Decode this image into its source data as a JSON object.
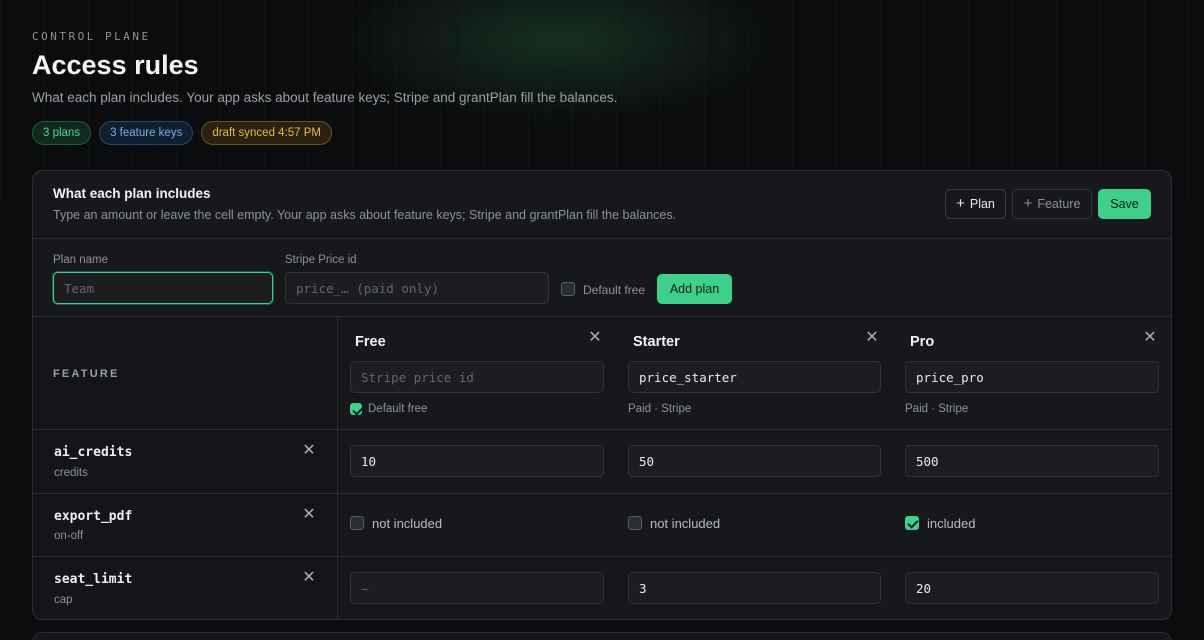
{
  "header": {
    "eyebrow": "CONTROL PLANE",
    "title": "Access rules",
    "subtitle": "What each plan includes. Your app asks about feature keys; Stripe and grantPlan fill the balances.",
    "pills": [
      "3 plans",
      "3 feature keys",
      "draft synced 4:57 PM"
    ]
  },
  "card": {
    "title": "What each plan includes",
    "subtitle": "Type an amount or leave the cell empty. Your app asks about feature keys; Stripe and grantPlan fill the balances.",
    "buttons": {
      "plan": "Plan",
      "feature": "Feature",
      "save": "Save"
    }
  },
  "add_plan": {
    "name_label": "Plan name",
    "name_placeholder": "Team",
    "price_label": "Stripe Price id",
    "price_placeholder": "price_… (paid only)",
    "default_free_label": "Default free",
    "add_button": "Add plan"
  },
  "grid": {
    "feature_header": "FEATURE",
    "plans": [
      {
        "name": "Free",
        "price_placeholder": "Stripe price id",
        "price_value": "",
        "note": "Default free",
        "default_free": true
      },
      {
        "name": "Starter",
        "price_placeholder": "",
        "price_value": "price_starter",
        "note": "Paid · Stripe",
        "default_free": false
      },
      {
        "name": "Pro",
        "price_placeholder": "",
        "price_value": "price_pro",
        "note": "Paid · Stripe",
        "default_free": false
      }
    ],
    "features": [
      {
        "key": "ai_credits",
        "unit": "credits",
        "cells": [
          "10",
          "50",
          "500"
        ]
      },
      {
        "key": "export_pdf",
        "unit": "on-off",
        "cells": [
          "not included",
          "not included",
          "included"
        ],
        "checked": [
          false,
          false,
          true
        ]
      },
      {
        "key": "seat_limit",
        "unit": "cap",
        "cells": [
          "",
          "3",
          "20"
        ],
        "placeholders": [
          "—",
          "",
          ""
        ]
      }
    ]
  },
  "colors": {
    "accent": "#3ecf8a",
    "background": "#0b0c0d",
    "card": "#16181b"
  }
}
